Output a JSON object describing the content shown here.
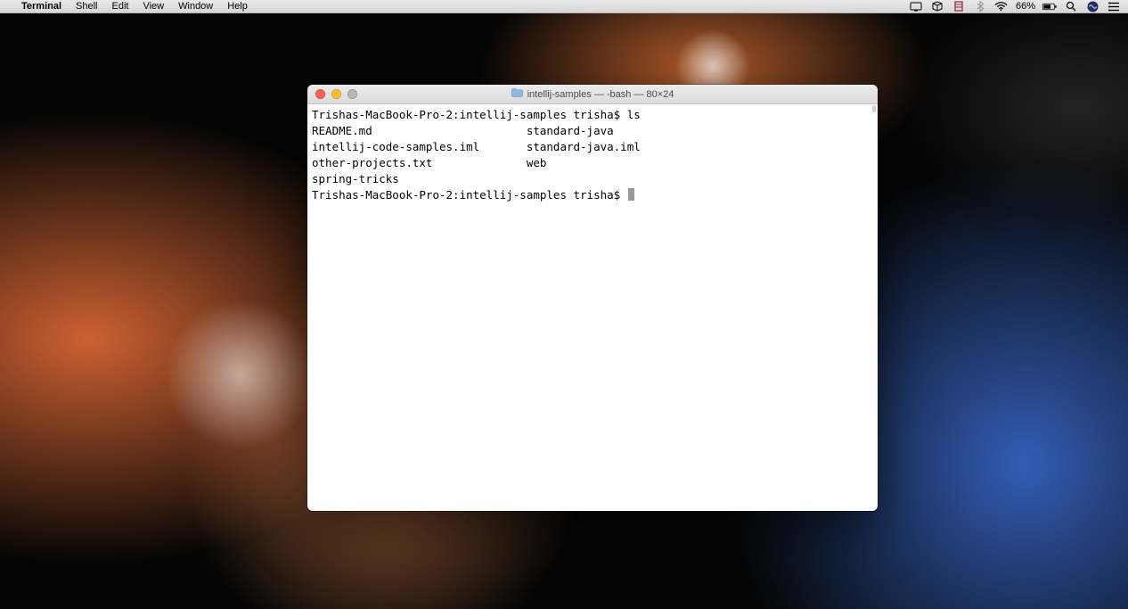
{
  "menubar": {
    "apple_glyph": "",
    "app_name": "Terminal",
    "menus": [
      "Shell",
      "Edit",
      "View",
      "Window",
      "Help"
    ],
    "battery_text": "66%"
  },
  "window": {
    "title": "intellij-samples — -bash — 80×24"
  },
  "terminal": {
    "line1": "Trishas-MacBook-Pro-2:intellij-samples trisha$ ls",
    "line2": "README.md                       standard-java",
    "line3": "intellij-code-samples.iml       standard-java.iml",
    "line4": "other-projects.txt              web",
    "line5": "spring-tricks",
    "prompt": "Trishas-MacBook-Pro-2:intellij-samples trisha$ "
  }
}
